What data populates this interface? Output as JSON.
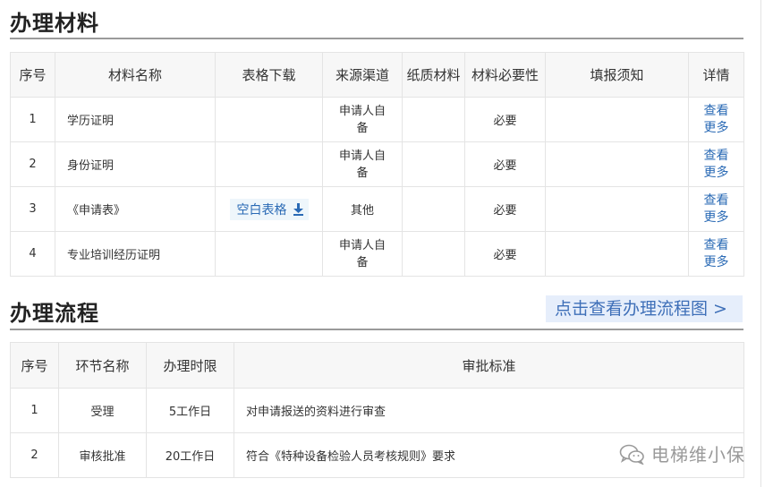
{
  "materials": {
    "title": "办理材料",
    "headers": [
      "序号",
      "材料名称",
      "表格下载",
      "来源渠道",
      "纸质材料",
      "材料必要性",
      "填报须知",
      "详情"
    ],
    "rows": [
      {
        "no": "1",
        "name": "学历证明",
        "download": "",
        "source_l1": "申请人自",
        "source_l2": "备",
        "paper": "",
        "necessity": "必要",
        "notes": "",
        "detail_l1": "查看",
        "detail_l2": "更多"
      },
      {
        "no": "2",
        "name": "身份证明",
        "download": "",
        "source_l1": "申请人自",
        "source_l2": "备",
        "paper": "",
        "necessity": "必要",
        "notes": "",
        "detail_l1": "查看",
        "detail_l2": "更多"
      },
      {
        "no": "3",
        "name": "《申请表》",
        "download": "空白表格",
        "source_l1": "其他",
        "source_l2": "",
        "paper": "",
        "necessity": "必要",
        "notes": "",
        "detail_l1": "查看",
        "detail_l2": "更多"
      },
      {
        "no": "4",
        "name": "专业培训经历证明",
        "download": "",
        "source_l1": "申请人自",
        "source_l2": "备",
        "paper": "",
        "necessity": "必要",
        "notes": "",
        "detail_l1": "查看",
        "detail_l2": "更多"
      }
    ]
  },
  "process": {
    "title": "办理流程",
    "flowchart_link": "点击查看办理流程图 >",
    "headers": [
      "序号",
      "环节名称",
      "办理时限",
      "审批标准"
    ],
    "rows": [
      {
        "no": "1",
        "step": "受理",
        "limit": "5工作日",
        "standard": "对申请报送的资料进行审查"
      },
      {
        "no": "2",
        "step": "审核批准",
        "limit": "20工作日",
        "standard": "符合《特种设备检验人员考核规则》要求"
      }
    ]
  },
  "watermark": {
    "text": "电梯维小保",
    "icon": "wechat-icon"
  },
  "colors": {
    "link": "#2a6ab5",
    "header_bg": "#f7f7f7",
    "flow_link_bg": "#e6eefb"
  }
}
